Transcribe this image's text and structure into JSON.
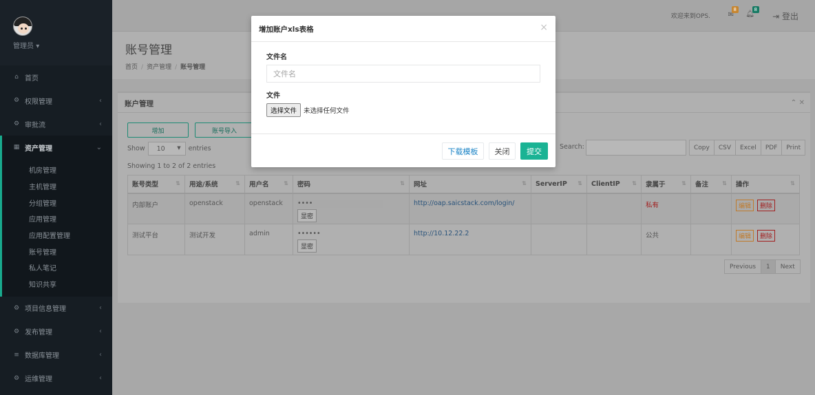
{
  "sidebar": {
    "role": "管理员",
    "items": [
      {
        "label": "首页",
        "icon": "home-icon",
        "has_children": false
      },
      {
        "label": "权限管理",
        "icon": "cogs-icon",
        "has_children": true
      },
      {
        "label": "审批流",
        "icon": "cogs-icon",
        "has_children": true
      },
      {
        "label": "资产管理",
        "icon": "grid-icon",
        "has_children": true,
        "active": true
      },
      {
        "label": "项目信息管理",
        "icon": "cogs-icon",
        "has_children": true
      },
      {
        "label": "发布管理",
        "icon": "cogs-icon",
        "has_children": true
      },
      {
        "label": "数据库管理",
        "icon": "list-icon",
        "has_children": true
      },
      {
        "label": "运维管理",
        "icon": "cogs-icon",
        "has_children": true
      }
    ],
    "subitems": [
      "机房管理",
      "主机管理",
      "分组管理",
      "应用管理",
      "应用配置管理",
      "账号管理",
      "私人笔记",
      "知识共享"
    ]
  },
  "topbar": {
    "welcome": "欢迎来到OPS.",
    "mail_count": "8",
    "alert_count": "8",
    "logout": "登出"
  },
  "heading": {
    "title": "账号管理",
    "breadcrumb": [
      "首页",
      "资产管理",
      "账号管理"
    ]
  },
  "panel": {
    "title": "账户管理",
    "add_button": "增加",
    "import_button": "账号导入",
    "show_label": "Show",
    "entries_value": "10",
    "entries_label": "entries",
    "search_label": "Search:",
    "export_buttons": [
      "Copy",
      "CSV",
      "Excel",
      "PDF",
      "Print"
    ],
    "showing": "Showing 1 to 2 of 2 entries"
  },
  "table": {
    "headers": [
      "账号类型",
      "用途/系统",
      "用户名",
      "密码",
      "网址",
      "ServerIP",
      "ClientIP",
      "隶属于",
      "备注",
      "操作"
    ],
    "rows": [
      {
        "type": "内部账户",
        "purpose": "openstack",
        "username": "openstack",
        "password": "••••",
        "url": "http://oap.saicstack.com/login/",
        "server_ip": "",
        "client_ip": "",
        "owner": "私有",
        "note": ""
      },
      {
        "type": "测试平台",
        "purpose": "测试开发",
        "username": "admin",
        "password": "••••••",
        "url": "http://10.12.22.2",
        "server_ip": "",
        "client_ip": "",
        "owner": "公共",
        "note": ""
      }
    ],
    "show_password_label": "显密",
    "edit_label": "编辑",
    "delete_label": "删除"
  },
  "pagination": {
    "previous": "Previous",
    "page": "1",
    "next": "Next"
  },
  "modal": {
    "title": "增加账户xls表格",
    "close_symbol": "×",
    "filename_label": "文件名",
    "filename_placeholder": "文件名",
    "file_label": "文件",
    "choose_file": "选择文件",
    "no_file": "未选择任何文件",
    "download_template": "下载模板",
    "close": "关闭",
    "submit": "提交"
  },
  "colors": {
    "sidebar_bg": "#161d23",
    "accent": "#1ab394",
    "link": "#1c84c6"
  }
}
